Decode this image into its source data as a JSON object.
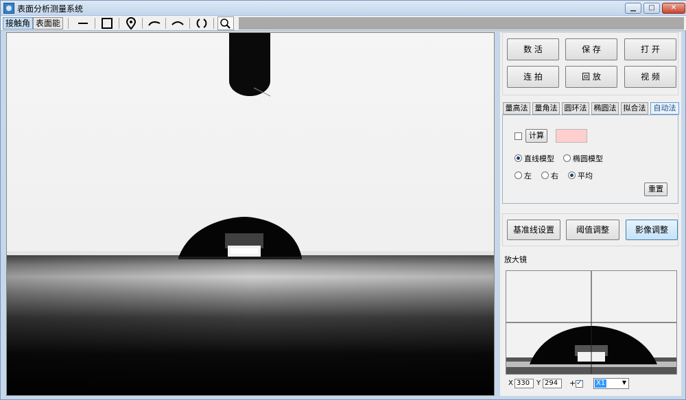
{
  "window": {
    "title": "表面分析测量系统",
    "controls": {
      "minimize": "▁",
      "maximize": "□",
      "close": "✕"
    }
  },
  "toolbar": {
    "mode_tabs": [
      "接触角",
      "表面能"
    ],
    "tools": [
      {
        "icon": "line-icon",
        "glyph": "—"
      },
      {
        "icon": "rectangle-icon",
        "glyph": "□"
      },
      {
        "icon": "location-pin-icon",
        "glyph": "⦿"
      },
      {
        "icon": "arc-left-icon",
        "glyph": "⌒"
      },
      {
        "icon": "arc-right-icon",
        "glyph": "⌒"
      },
      {
        "icon": "circle-icon",
        "glyph": "( )"
      },
      {
        "icon": "zoom-icon",
        "glyph": "🔍"
      }
    ]
  },
  "buttons_top": {
    "b1": "数 活",
    "b2": "保 存",
    "b3": "打 开",
    "b4": "连 拍",
    "b5": "回 放",
    "b6": "视 频"
  },
  "method_tabs": [
    "量高法",
    "量角法",
    "圆环法",
    "椭圆法",
    "拟合法",
    "自动法"
  ],
  "method_active_index": 5,
  "auto_panel": {
    "compute_label": "计算",
    "model_options": [
      "直线模型",
      "椭圆模型"
    ],
    "model_selected": "直线模型",
    "side_options": [
      "左",
      "右",
      "平均"
    ],
    "side_selected": "平均",
    "reset_label": "重置"
  },
  "buttons_mid": {
    "baseline": "基准线设置",
    "threshold": "阈值调整",
    "image_adjust": "影像调整"
  },
  "magnifier": {
    "label": "放大镜"
  },
  "coords": {
    "x_label": "X",
    "x_value": "330",
    "y_label": "Y",
    "y_value": "294",
    "crosshair_label": "+",
    "zoom_value": "X1"
  },
  "colors": {
    "active_tab": "#c7ddf3",
    "highlight": "#3399ff",
    "pink_result": "#ffcfcf"
  }
}
